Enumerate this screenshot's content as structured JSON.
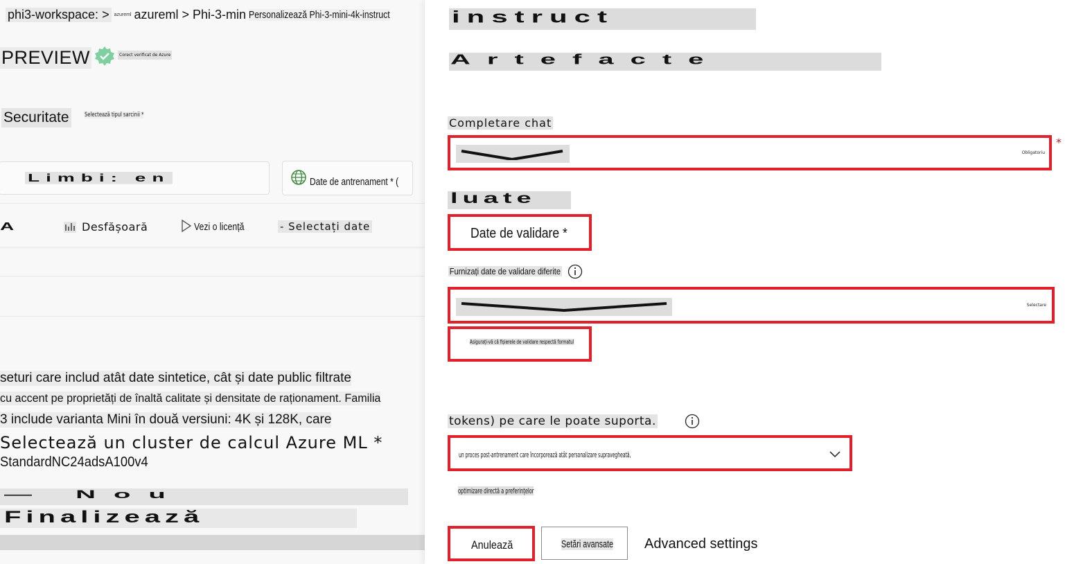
{
  "breadcrumb": {
    "workspace": "phi3-workspace: >",
    "tiny_segment": "azureml",
    "registry": "azureml > Phi-3-min",
    "page": "Personalizează Phi-3-mini-4k-instruct"
  },
  "header": {
    "preview_label": "PREVIEW",
    "badge_text": "Corect verificat de Azure"
  },
  "filters": {
    "security_label": "Securitate",
    "task_type_label": "Selectează tipul sarcinii *",
    "languages_label": "Limbi: en",
    "training_data_label": "Date de antrenament * ("
  },
  "toolbar": {
    "a_label": "A",
    "deploy_label": "Desfășoară",
    "license_label": "Vezi o licență",
    "select_data_label": "- Selectați date"
  },
  "description": {
    "line1": "seturi care includ atât date sintetice, cât și date public filtrate",
    "line2": "cu accent pe proprietăți de înaltă calitate și densitate de raționament. Familia",
    "line3": "3 include varianta Mini în două versiuni: 4K și 128K, care"
  },
  "compute": {
    "cluster_label": "Selectează un cluster de calcul Azure ML *",
    "sku": "StandardNC24adsA100v4",
    "new_label": "— Nou",
    "finalize_label": "Finalizează"
  },
  "panel": {
    "title": "instruct",
    "artifacts_heading": "Artefacte",
    "chat_completion_label": "Completare chat",
    "chat_dropdown_hint": "Obligatoriu",
    "taken_heading": "luate",
    "validation_label": "Date de validare *",
    "provide_validation_label": "Furnizați date de validare diferite",
    "validation_dropdown_hint": "Selectare",
    "validation_note": "Asigurați-vă că fișierele de validare respectă formatul",
    "tokens_label": "tokens) pe care le poate suporta.",
    "tokens_dropdown_value": "un proces post-antrenament care încorporează atât personalizare supravegheată,",
    "footnote": "optimizare directă a preferințelor",
    "cancel_label": "Anulează",
    "advanced_button_label": "Setări avansate",
    "advanced_link_label": "Advanced settings"
  },
  "colors": {
    "highlight_red": "#e0202a",
    "required_star": "#a4262c",
    "badge_green": "#7ed0a0"
  }
}
